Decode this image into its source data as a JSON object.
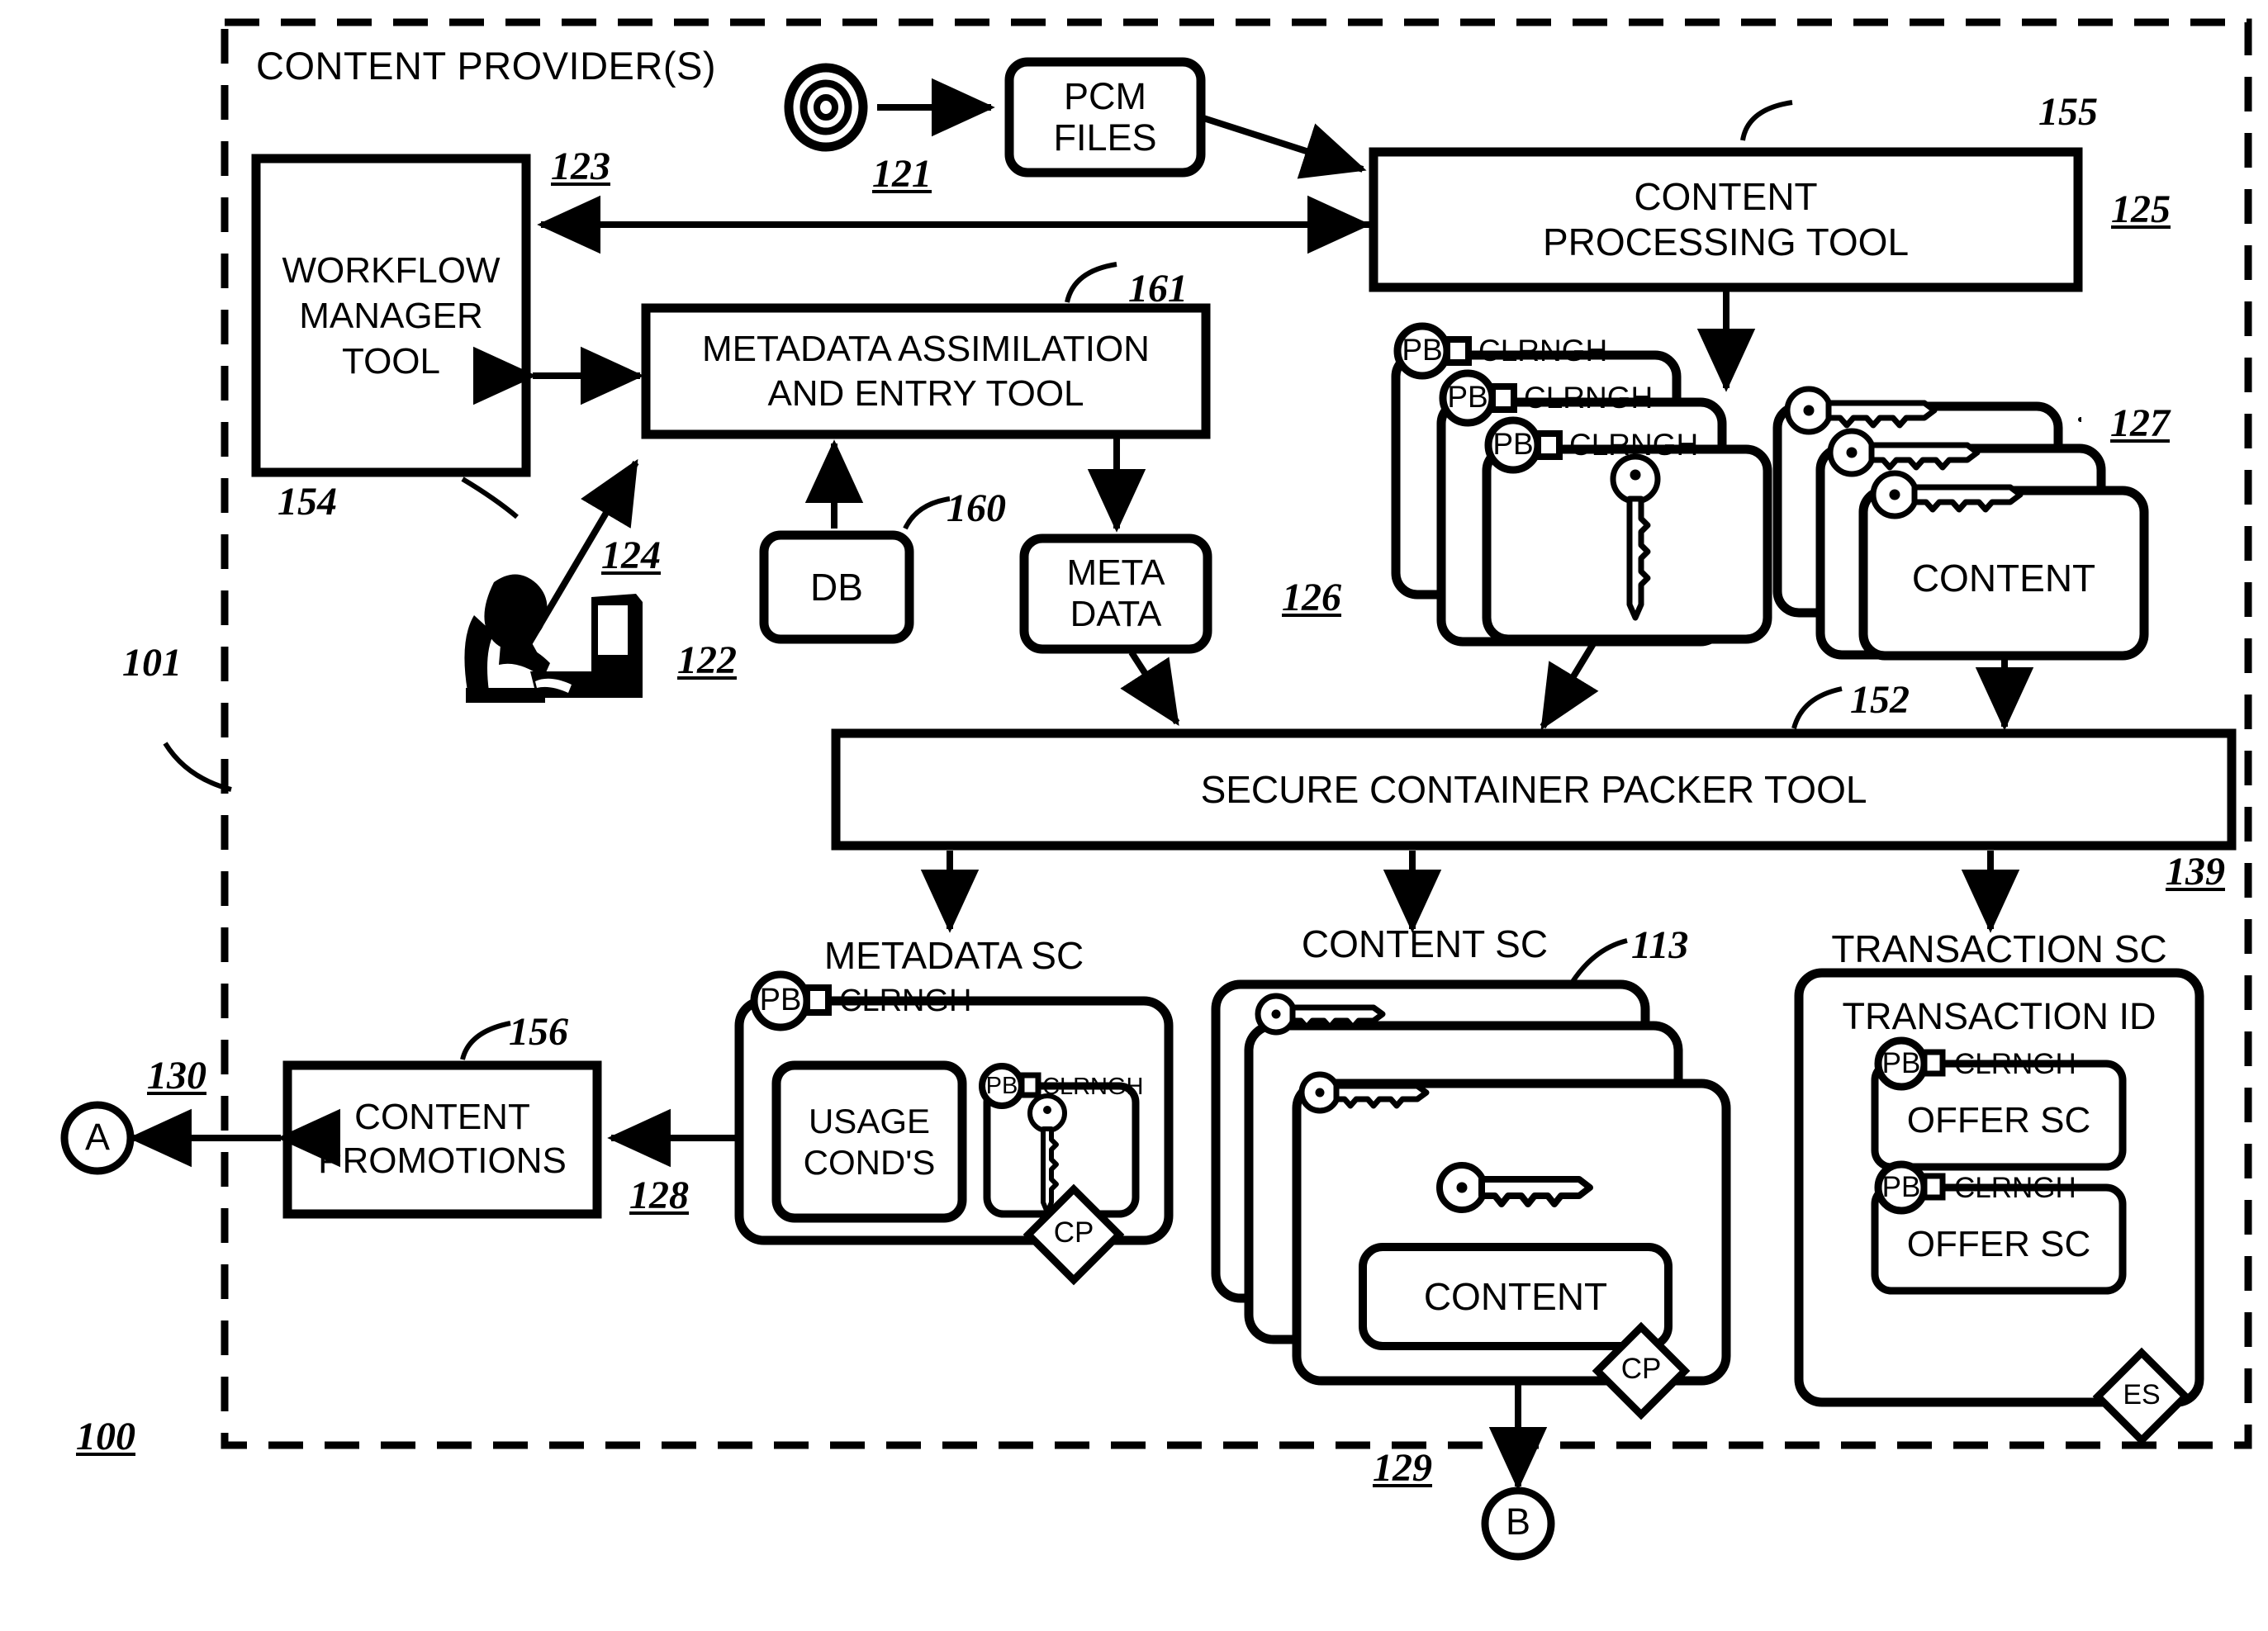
{
  "figure": {
    "title": "CONTENT PROVIDER(S)",
    "domain_label": "patent-block-diagram"
  },
  "boundary": {
    "label": "CONTENT PROVIDER(S)",
    "ref_outer": "100",
    "ref_inner": "101"
  },
  "nodes": {
    "source_disc": {
      "ref": "121",
      "icon": "concentric-circle-icon"
    },
    "pcm_files": {
      "label": "PCM\nFILES"
    },
    "content_processing_tool": {
      "label": "CONTENT\nPROCESSING TOOL",
      "ref_lead": "155",
      "ref_side": "125"
    },
    "workflow_manager_tool": {
      "label": "WORKFLOW\nMANAGER\nTOOL",
      "ref_top": "123",
      "ref_lead": "154"
    },
    "metadata_assimilation_tool": {
      "label": "METADATA ASSIMILATION\nAND ENTRY TOOL",
      "ref_lead": "161"
    },
    "operator": {
      "ref": "124",
      "ref_sub": "122",
      "icon": "person-at-computer-icon"
    },
    "db": {
      "label": "DB",
      "ref_lead": "160"
    },
    "meta_data": {
      "label": "META\nDATA"
    },
    "key_container_stack": {
      "ref": "126",
      "badge": "PB",
      "badge_label": "CLRNGH",
      "count": 3,
      "icon": "key-icon"
    },
    "content_stack": {
      "label": "CONTENT",
      "ref": "127",
      "count": 3,
      "icon": "key-icon"
    },
    "secure_container_packer_tool": {
      "label": "SECURE CONTAINER PACKER TOOL",
      "ref_lead": "152",
      "ref_side": "139"
    },
    "metadata_sc": {
      "title": "METADATA SC",
      "badge": "PB",
      "badge_label": "CLRNGH",
      "usage_conditions": "USAGE\nCOND'S",
      "inner_badge": "PB",
      "inner_badge_label": "CLRNGH",
      "seal": "CP",
      "ref": "128"
    },
    "content_sc": {
      "title": "CONTENT SC",
      "ref": "113",
      "inner_label": "CONTENT",
      "seal": "CP",
      "count": 3
    },
    "transaction_sc": {
      "title": "TRANSACTION SC",
      "transaction_id": "TRANSACTION ID",
      "offers": [
        {
          "badge": "PB",
          "badge_label": "CLRNGH",
          "label": "OFFER SC"
        },
        {
          "badge": "PB",
          "badge_label": "CLRNGH",
          "label": "OFFER SC"
        }
      ],
      "seal": "ES"
    },
    "content_promotions": {
      "label": "CONTENT\nPROMOTIONS",
      "ref_lead": "156"
    },
    "connector_a": {
      "label": "A",
      "ref": "130"
    },
    "connector_b": {
      "label": "B",
      "ref": "129"
    }
  }
}
